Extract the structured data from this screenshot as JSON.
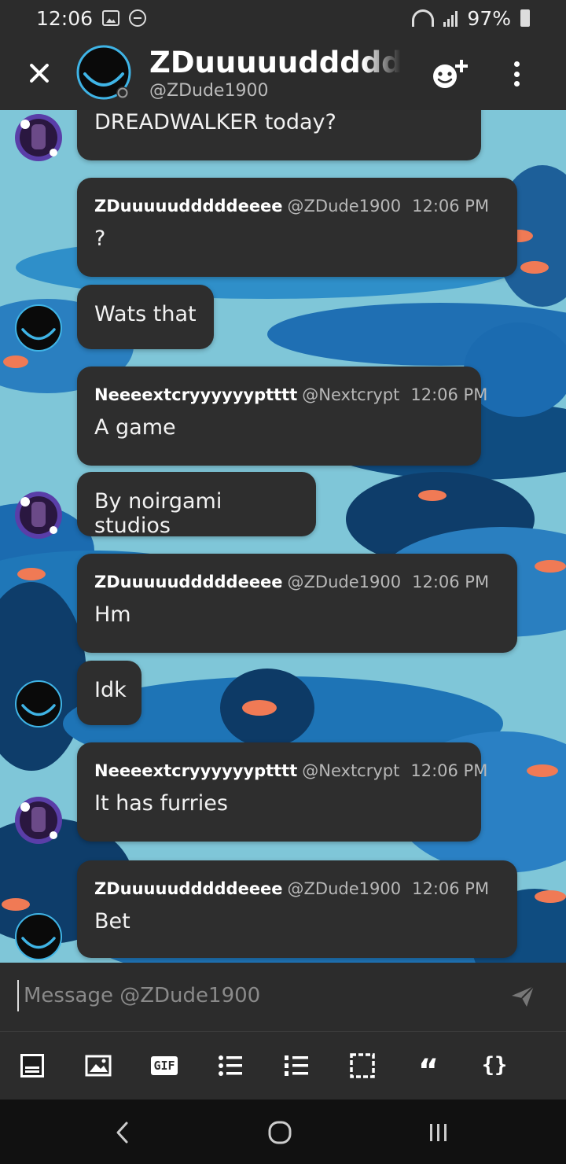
{
  "status_bar": {
    "time": "12:06",
    "battery": "97%",
    "icons": [
      "gallery-notification-icon",
      "do-not-disturb-icon",
      "wifi-icon",
      "signal-icon",
      "battery-icon"
    ]
  },
  "header": {
    "title": "ZDuuuuudddddde",
    "handle": "@ZDude1900",
    "icons": [
      "close-icon",
      "add-friend-icon",
      "more-icon"
    ]
  },
  "colors": {
    "bubble": "#2e2e2e",
    "bar": "#2c2c2c",
    "chat_background": "#7fc6d8"
  },
  "messages": [
    {
      "author": "",
      "handle": "",
      "time": "",
      "text": "DREADWALKER today?",
      "avatar": "nextcrypt"
    },
    {
      "author": "ZDuuuuudddddeeee",
      "handle": "@ZDude1900",
      "time": "12:06 PM",
      "text": "?",
      "avatar": ""
    },
    {
      "author": "",
      "handle": "",
      "time": "",
      "text": "Wats that",
      "avatar": "zdude"
    },
    {
      "author": "Neeeextcryyyyyyptttt",
      "handle": "@Nextcrypt",
      "time": "12:06 PM",
      "text": "A game",
      "avatar": ""
    },
    {
      "author": "",
      "handle": "",
      "time": "",
      "text": "By noirgami studios",
      "avatar": "nextcrypt"
    },
    {
      "author": "ZDuuuuudddddeeee",
      "handle": "@ZDude1900",
      "time": "12:06 PM",
      "text": "Hm",
      "avatar": ""
    },
    {
      "author": "",
      "handle": "",
      "time": "",
      "text": "Idk",
      "avatar": "zdude"
    },
    {
      "author": "Neeeextcryyyyyyptttt",
      "handle": "@Nextcrypt",
      "time": "12:06 PM",
      "text": "It has furries",
      "avatar": "nextcrypt"
    },
    {
      "author": "ZDuuuuudddddeeee",
      "handle": "@ZDude1900",
      "time": "12:06 PM",
      "text": "Bet",
      "avatar": "zdude"
    }
  ],
  "composer": {
    "placeholder": "Message @ZDude1900"
  },
  "toolbar": {
    "gif_label": "GIF",
    "quote_label": "“",
    "code_label": "{}",
    "icons": [
      "spoiler-icon",
      "image-icon",
      "gif-icon",
      "bulleted-list-icon",
      "numbered-list-icon",
      "select-icon",
      "quote-icon",
      "code-icon"
    ]
  },
  "navbar": {
    "icons": [
      "back-icon",
      "home-icon",
      "recents-icon"
    ]
  }
}
